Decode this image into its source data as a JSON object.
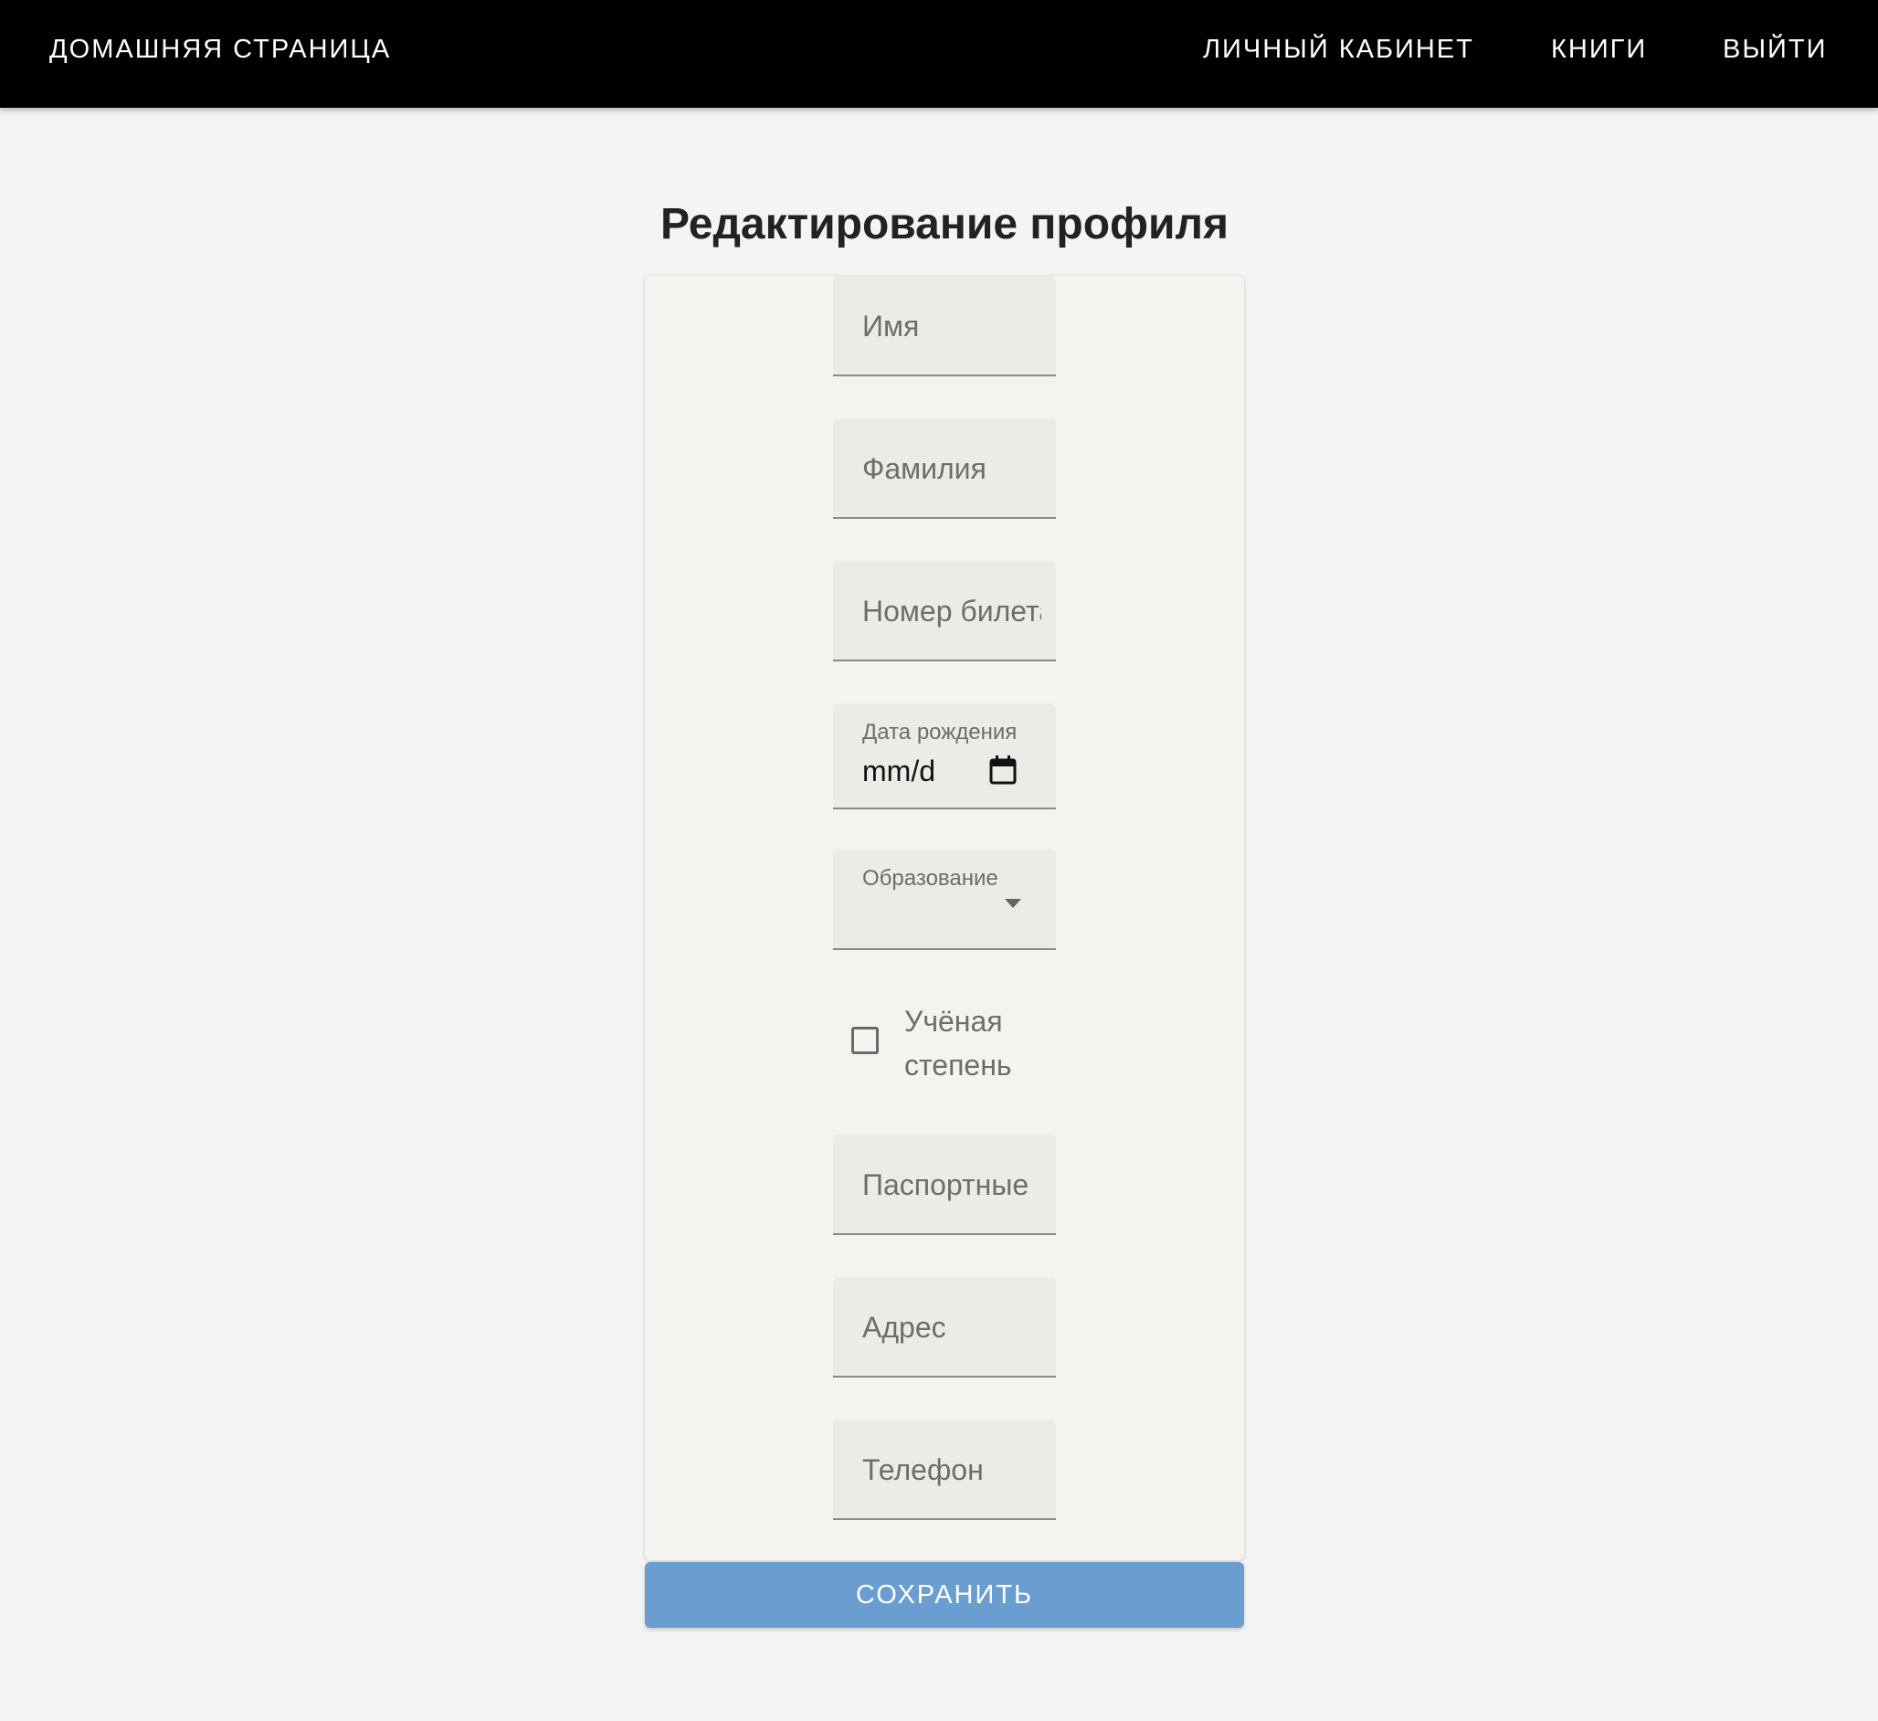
{
  "nav": {
    "home": "ДОМАШНЯЯ СТРАНИЦА",
    "cabinet": "ЛИЧНЫЙ КАБИНЕТ",
    "books": "КНИГИ",
    "logout": "ВЫЙТИ"
  },
  "page": {
    "title": "Редактирование профиля"
  },
  "form": {
    "first_name": {
      "placeholder": "Имя"
    },
    "last_name": {
      "placeholder": "Фамилия"
    },
    "ticket_number": {
      "placeholder": "Номер билета"
    },
    "birth_date": {
      "label": "Дата рождения",
      "value": "mm/d"
    },
    "education": {
      "label": "Образование",
      "value": ""
    },
    "degree": {
      "label": "Учёная степень",
      "checked": false
    },
    "passport": {
      "placeholder": "Паспортные"
    },
    "address": {
      "placeholder": "Адрес"
    },
    "phone": {
      "placeholder": "Телефон"
    },
    "save_label": "СОХРАНИТЬ"
  },
  "colors": {
    "topbar": "#000000",
    "background": "#f4f4f4",
    "card": "#f4f3ef",
    "field": "#ecebe7",
    "save_button": "#6a9ed0"
  },
  "icons": {
    "calendar": "calendar-icon",
    "dropdown": "chevron-down-icon",
    "checkbox": "checkbox-icon"
  }
}
